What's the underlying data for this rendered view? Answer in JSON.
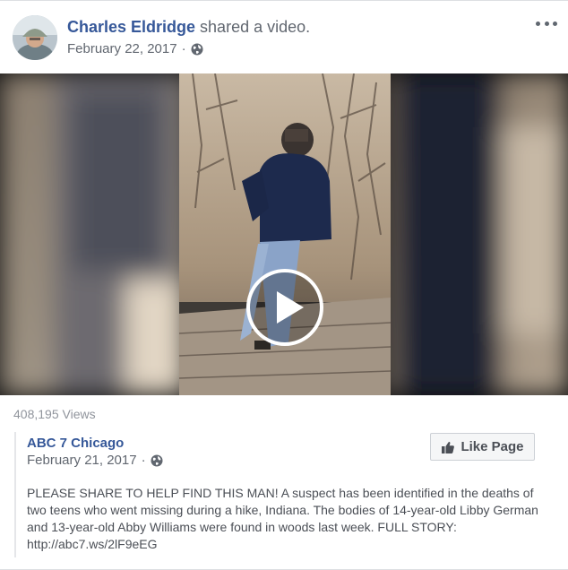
{
  "post": {
    "author_name": "Charles Eldridge",
    "author_action": "shared a video.",
    "date": "February 22, 2017",
    "separator": "·",
    "privacy_icon": "globe-icon",
    "more_icon": "more-options-icon"
  },
  "video": {
    "play_icon": "play-icon",
    "views": "408,195 Views"
  },
  "shared_page": {
    "name": "ABC 7 Chicago",
    "date": "February 21, 2017",
    "separator": "·",
    "privacy_icon": "globe-icon",
    "like_button_label": "Like Page",
    "like_icon": "thumbs-up-icon",
    "description": "PLEASE SHARE TO HELP FIND THIS MAN! A suspect has been identified in the deaths of two teens who went missing during a hike, Indiana. The bodies of 14-year-old Libby German and 13-year-old Abby Williams were found in woods last week. FULL STORY: ",
    "link": "http://abc7.ws/2lF9eEG"
  },
  "colors": {
    "link_blue": "#365899",
    "meta_gray": "#616770",
    "views_gray": "#90949c"
  }
}
